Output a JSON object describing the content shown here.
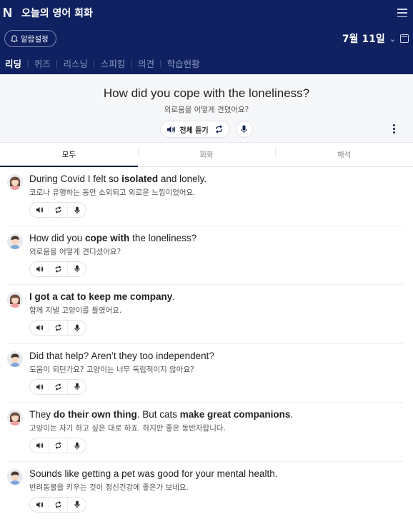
{
  "header": {
    "logo": "N",
    "title": "오늘의 영어 회화",
    "alarm_label": "알람설정",
    "date": "7월 11일",
    "date_arrow": "⌄"
  },
  "nav": [
    {
      "label": "리딩",
      "active": true
    },
    {
      "label": "퀴즈",
      "active": false
    },
    {
      "label": "리스닝",
      "active": false
    },
    {
      "label": "스피킹",
      "active": false
    },
    {
      "label": "의견",
      "active": false
    },
    {
      "label": "학습현황",
      "active": false
    }
  ],
  "sentence": {
    "english": "How did you cope with the loneliness?",
    "korean": "외로움을 어떻게 견뎠어요?",
    "listen_all_label": "전체 듣기"
  },
  "tabs": [
    {
      "label": "모두",
      "active": true
    },
    {
      "label": "회화",
      "active": false
    },
    {
      "label": "해석",
      "active": false
    }
  ],
  "dialog": [
    {
      "speaker": "female",
      "parts": [
        {
          "t": "During Covid I felt so ",
          "b": false
        },
        {
          "t": "isolated",
          "b": true
        },
        {
          "t": " and lonely.",
          "b": false
        }
      ],
      "korean": "코로나 유행하는 동안 소외되고 외로운 느낌이었어요."
    },
    {
      "speaker": "male",
      "parts": [
        {
          "t": "How did you ",
          "b": false
        },
        {
          "t": "cope with",
          "b": true
        },
        {
          "t": " the loneliness?",
          "b": false
        }
      ],
      "korean": "외로움을 어떻게 견디셨어요?"
    },
    {
      "speaker": "female",
      "parts": [
        {
          "t": "I got a cat to keep me company",
          "b": true
        },
        {
          "t": ".",
          "b": false
        }
      ],
      "korean": "함께 지낼 고양이를 들였어요."
    },
    {
      "speaker": "male",
      "parts": [
        {
          "t": "Did that help? Aren’t they too independent?",
          "b": false
        }
      ],
      "korean": "도움이 되던가요? 고양이는 너무 독립적이지 않아요?"
    },
    {
      "speaker": "female",
      "parts": [
        {
          "t": "They ",
          "b": false
        },
        {
          "t": "do their own thing",
          "b": true
        },
        {
          "t": ". But cats ",
          "b": false
        },
        {
          "t": "make great companions",
          "b": true
        },
        {
          "t": ".",
          "b": false
        }
      ],
      "korean": "고양이는 자기 하고 싶은 대로 하죠. 하지만 좋은 동반자랍니다."
    },
    {
      "speaker": "male",
      "parts": [
        {
          "t": "Sounds like getting a pet was good for your mental health.",
          "b": false
        }
      ],
      "korean": "반려동물을 키우는 것이 정신건강에 좋은가 보네요."
    }
  ],
  "icons": {
    "speaker": "speaker-icon",
    "repeat": "repeat-icon",
    "mic": "mic-icon",
    "bell": "bell-icon",
    "calendar": "calendar-icon",
    "menu": "menu-icon"
  },
  "colors": {
    "header_bg": "#0f2160",
    "accent": "#15234f"
  }
}
